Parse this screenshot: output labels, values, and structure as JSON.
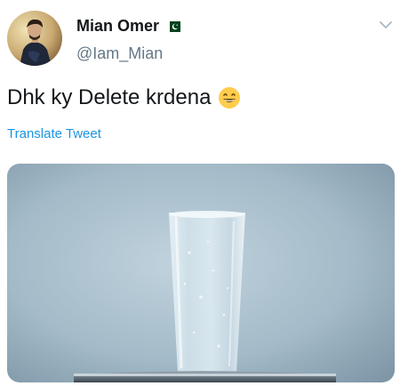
{
  "tweet": {
    "display_name": "Mian Omer",
    "handle": "@Iam_Mian",
    "text": "Dhk ky Delete krdena",
    "translate_label": "Translate Tweet",
    "icons": {
      "avatar": "avatar",
      "flag": "pakistan-flag-icon",
      "menu": "chevron-down-icon",
      "emoji": "grinning-face-emoji-icon"
    }
  },
  "colors": {
    "name": "#14171a",
    "handle": "#657786",
    "link": "#1b95e0",
    "media_bg": "#a9c0ce",
    "flag_green": "#01411c"
  }
}
